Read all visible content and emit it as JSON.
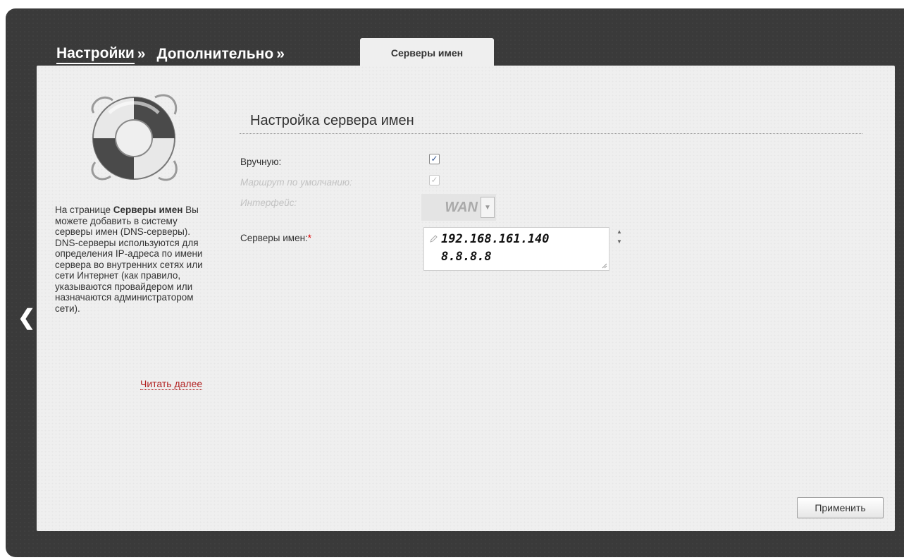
{
  "breadcrumb": {
    "items": [
      {
        "label": "Настройки",
        "sep": "»"
      },
      {
        "label": "Дополнительно",
        "sep": "»"
      }
    ]
  },
  "tab": {
    "label": "Серверы имен"
  },
  "help": {
    "prefix": "На странице ",
    "bold": "Серверы имен",
    "text": " Вы можете добавить в систему серверы имен (DNS-серверы). DNS-серверы используются для определения IP-адреса по имени сервера во внутренних сетях или сети Интернет (как правило, указываются провайдером или назначаются администратором сети).",
    "read_more": "Читать далее"
  },
  "section": {
    "title": "Настройка сервера имен"
  },
  "form": {
    "manual": {
      "label": "Вручную:",
      "checked": true
    },
    "default_route": {
      "label": "Маршрут по умолчанию:",
      "checked": true,
      "disabled": true
    },
    "interface": {
      "label": "Интерфейс:",
      "value": "WAN",
      "disabled": true
    },
    "name_servers": {
      "label": "Серверы имен:",
      "required_mark": "*",
      "values": [
        "192.168.161.140",
        "8.8.8.8"
      ]
    }
  },
  "buttons": {
    "apply": "Применить"
  },
  "icons": {
    "back": "chevron-left-icon",
    "lifebuoy": "lifebuoy-icon",
    "dropdown": "chevron-down-icon",
    "pencil": "pencil-icon"
  }
}
